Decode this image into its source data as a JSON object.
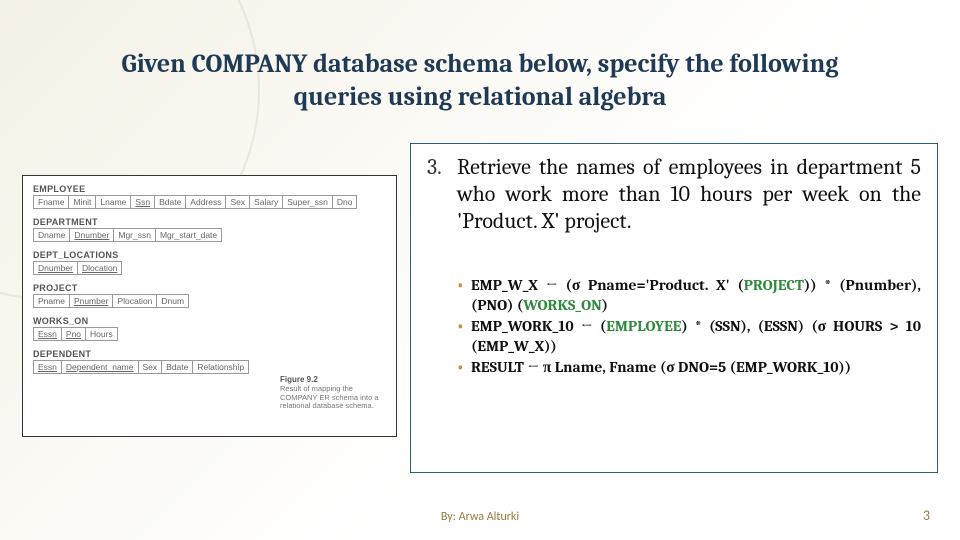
{
  "title": "Given COMPANY database schema below, specify the following queries using relational algebra",
  "schema": {
    "relations": [
      {
        "name": "EMPLOYEE",
        "attrs": [
          "Fname",
          "Minit",
          "Lname",
          "Ssn",
          "Bdate",
          "Address",
          "Sex",
          "Salary",
          "Super_ssn",
          "Dno"
        ],
        "keys": [
          "Ssn"
        ]
      },
      {
        "name": "DEPARTMENT",
        "attrs": [
          "Dname",
          "Dnumber",
          "Mgr_ssn",
          "Mgr_start_date"
        ],
        "keys": [
          "Dnumber"
        ]
      },
      {
        "name": "DEPT_LOCATIONS",
        "attrs": [
          "Dnumber",
          "Dlocation"
        ],
        "keys": [
          "Dnumber",
          "Dlocation"
        ]
      },
      {
        "name": "PROJECT",
        "attrs": [
          "Pname",
          "Pnumber",
          "Plocation",
          "Dnum"
        ],
        "keys": [
          "Pnumber"
        ]
      },
      {
        "name": "WORKS_ON",
        "attrs": [
          "Essn",
          "Pno",
          "Hours"
        ],
        "keys": [
          "Essn",
          "Pno"
        ]
      },
      {
        "name": "DEPENDENT",
        "attrs": [
          "Essn",
          "Dependent_name",
          "Sex",
          "Bdate",
          "Relationship"
        ],
        "keys": [
          "Essn",
          "Dependent_name"
        ]
      }
    ],
    "figure_label": "Figure 9.2",
    "figure_caption": "Result of mapping the COMPANY ER schema into a relational database schema."
  },
  "question": {
    "number": "3.",
    "text": "Retrieve the names of employees in department 5 who work more than 10 hours per week on the 'Product. X' project."
  },
  "answers": [
    {
      "lhs": "EMP_W_X",
      "expr_html": "(<span class='sig'>σ</span> Pname='Product. X' (<span class='g'>PROJECT</span>)) * (Pnumber), (PNO) (<span class='g'>WORKS_ON</span>)"
    },
    {
      "lhs": "EMP_WORK_10",
      "expr_html": "(<span class='g'>EMPLOYEE</span>) * (SSN), (ESSN) (<span class='sig'>σ</span> HOURS &gt; 10 (EMP_W_X))"
    },
    {
      "lhs": "RESULT",
      "expr_html": "<span class='sig'>π</span> Lname, Fname (<span class='sig'>σ</span> DNO=5 (EMP_WORK_10))"
    }
  ],
  "footer": {
    "author": "By: Arwa Alturki",
    "page": "3"
  }
}
